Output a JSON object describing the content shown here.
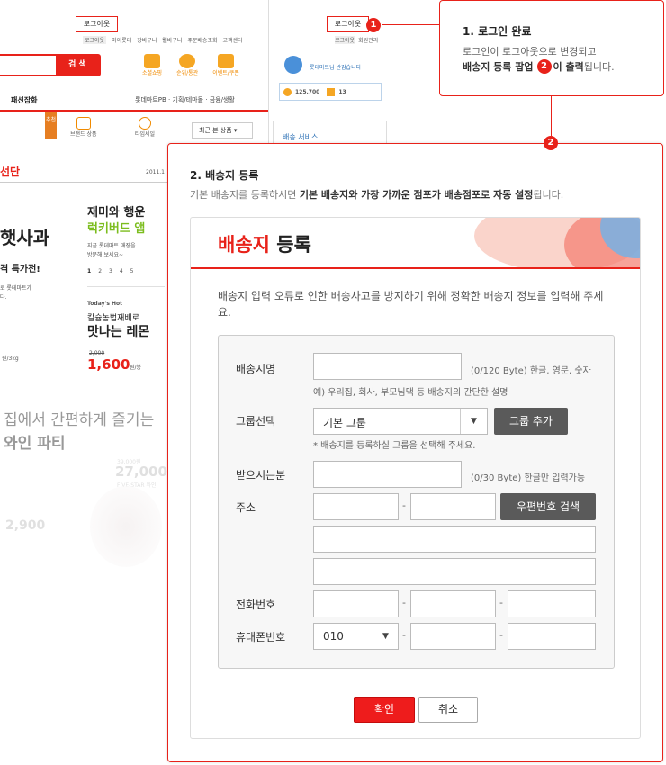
{
  "bg": {
    "logout_top": "로그아웃",
    "nav_links": [
      "로그아웃",
      "마이롯데",
      "장바구니",
      "웰바구니",
      "주문배송조회",
      "고객센터"
    ],
    "search_button": "검 색",
    "quick_icons": [
      "소셜쇼핑",
      "순위/통관",
      "이벤트/쿠폰"
    ],
    "category": "패션잡화",
    "subnav": "롯데마트PB · 기획/테마몰 · 금융/생활",
    "logout_side": "로그아웃",
    "member_manage": "회원관리",
    "welcome": "롯데마트님 반갑습니다",
    "points": "125,700",
    "coupons": "13",
    "recommend_tag": "추천",
    "brand_product": "브랜드 상품",
    "time_sale": "타임세일",
    "recent_dropdown": "최근 본 상품",
    "delivery_service": "배송 서비스",
    "banner_title": "선단",
    "date": "2011.1",
    "promo_title": "햇사과",
    "promo_sub": "격 특가전!",
    "promo_desc1": "로 롯데마트가",
    "promo_desc2": "다.",
    "promo_unit": "원/3kg",
    "fun_title": "재미와 행운",
    "fun_app": "럭키버드 앱",
    "fun_desc1": "지금 롯데마트 매장을",
    "fun_desc2": "방문해 보세요~",
    "pages": [
      "1",
      "2",
      "3",
      "4",
      "5"
    ],
    "hot_label": "Today's Hot",
    "hot_desc": "칼슘농법재배로",
    "hot_title": "맛나는 레몬",
    "hot_old_price": "2,000",
    "hot_price": "1,600",
    "hot_unit": "원/봉",
    "wine_line1": "집에서 간편하게 즐기는",
    "wine_line2": "와인 파티",
    "wine_old_price": "39,000원",
    "wine_price": "27,000",
    "wine_label": "FIVE-STAR 와인",
    "faint_price": "2,900"
  },
  "callout": {
    "badge": "1",
    "title": "1. 로그인 완료",
    "line1": "로그인이 로그아웃으로 변경되고",
    "line2_bold": "배송지 등록 팝업",
    "line2_badge": "2",
    "line2_bold2": "이 출력",
    "line2_end": "됩니다."
  },
  "popup": {
    "badge": "2",
    "title": "2. 배송지 등록",
    "desc_normal": "기본 배송지를 등록하시면 ",
    "desc_bold": "기본 배송지와 가장 가까운 점포가 배송점포로 자동 설정",
    "desc_end": "됩니다."
  },
  "dialog": {
    "title_red": "배송지",
    "title_black": " 등록",
    "intro": "배송지 입력 오류로 인한 배송사고를 방지하기 위해 정확한 배송지 정보를 입력해 주세요.",
    "name_label": "배송지명",
    "name_hint": "(0/120 Byte) 한글, 영문, 숫자",
    "name_example": "예) 우리집, 회사, 부모님댁 등 배송지의 간단한 설명",
    "group_label": "그룹선택",
    "group_value": "기본 그룹",
    "group_add": "그룹 추가",
    "group_hint": "* 배송지를 등록하실 그룹을 선택해 주세요.",
    "recipient_label": "받으시는분",
    "recipient_hint": "(0/30 Byte) 한글만 입력가능",
    "address_label": "주소",
    "zip_search": "우편번호 검색",
    "phone_label": "전화번호",
    "mobile_label": "휴대폰번호",
    "mobile_prefix": "010",
    "dash": "-",
    "confirm": "확인",
    "cancel": "취소"
  },
  "colors": {
    "accent": "#e8221a",
    "orange": "#f08a00",
    "dark_button": "#5a5a5a"
  }
}
